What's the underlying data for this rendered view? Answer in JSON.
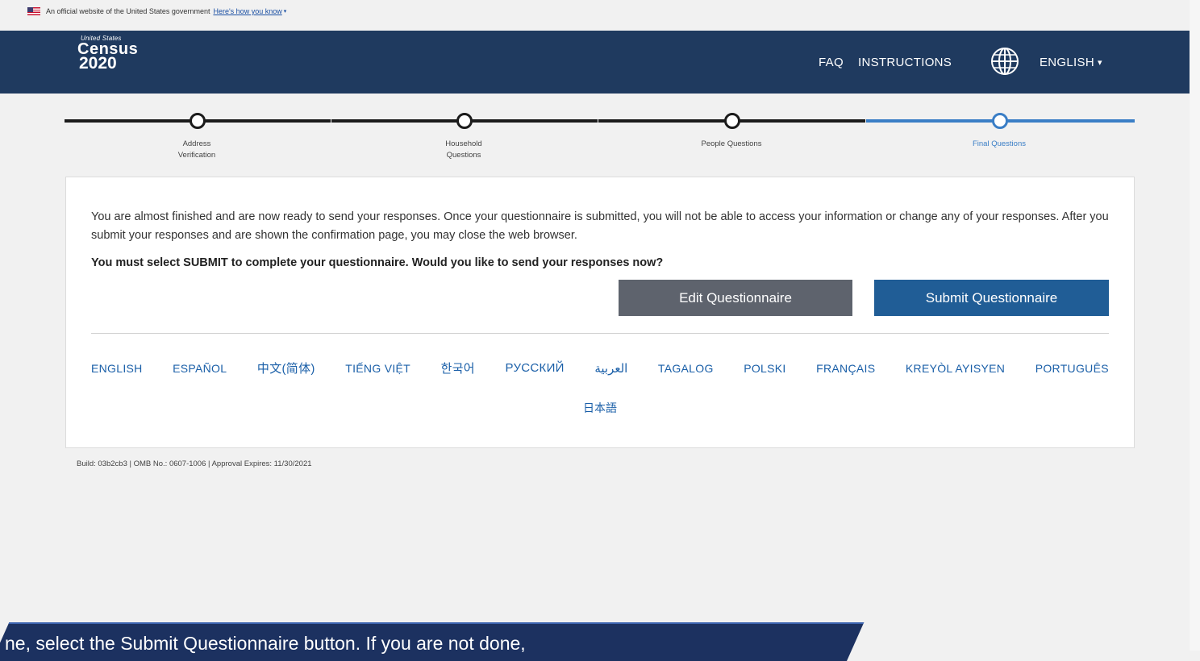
{
  "gov_banner": {
    "text": "An official website of the United States government",
    "link": "Here's how you know",
    "caret": "▾"
  },
  "header": {
    "logo": {
      "line1": "United States",
      "line2": "Census",
      "line3": "2020"
    },
    "nav": {
      "faq": "FAQ",
      "instructions": "INSTRUCTIONS",
      "language": "ENGLISH",
      "language_caret": "▾"
    }
  },
  "progress": {
    "steps": [
      {
        "label": "Address Verification",
        "state": "done"
      },
      {
        "label": "Household Questions",
        "state": "done"
      },
      {
        "label": "People Questions",
        "state": "done"
      },
      {
        "label": "Final Questions",
        "state": "active"
      }
    ]
  },
  "main": {
    "message": "You are almost finished and are now ready to send your responses. Once your questionnaire is submitted, you will not be able to access your information or change any of your responses. After you submit your responses and are shown the confirmation page, you may close the web browser.",
    "question": "You must select SUBMIT to complete your questionnaire. Would you like to send your responses now?",
    "edit_button": "Edit Questionnaire",
    "submit_button": "Submit Questionnaire"
  },
  "languages": [
    "ENGLISH",
    "ESPAÑOL",
    "中文(简体)",
    "TIẾNG VIỆT",
    "한국어",
    "РУССКИЙ",
    "العربية",
    "TAGALOG",
    "POLSKI",
    "FRANÇAIS",
    "KREYÒL AYISYEN",
    "PORTUGUÊS",
    "日本語"
  ],
  "footer": {
    "build": "Build: 03b2cb3 | OMB No.: 0607-1006 | Approval Expires: 11/30/2021"
  },
  "callout": {
    "text": "ne, select the Submit Questionnaire button. If you are not done,"
  },
  "colors": {
    "header_bg": "#1f3a5f",
    "active_step": "#3a7ec6",
    "edit_button": "#5e636d",
    "submit_button": "#205d96",
    "link": "#1a5fa8",
    "callout_bg": "#1c3160"
  }
}
